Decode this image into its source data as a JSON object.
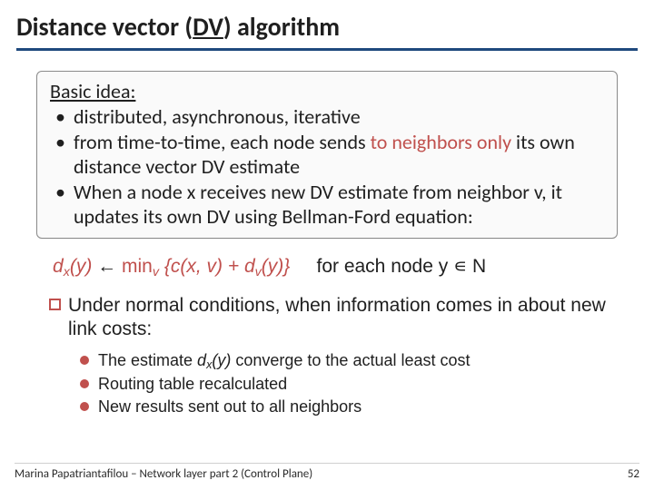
{
  "title": {
    "pre": "Distance vector (",
    "dv": "DV",
    "post": ") algorithm"
  },
  "box": {
    "heading": "Basic idea:",
    "bullets": [
      {
        "pre": "distributed, asynchronous, iterative",
        "accent": "",
        "post": ""
      },
      {
        "pre": "from time-to-time, each node sends ",
        "accent": "to neighbors only ",
        "post": "its own distance vector DV estimate"
      },
      {
        "pre": "When a node x receives new DV estimate from neighbor v, it updates its own DV using Bellman-Ford equation:",
        "accent": "",
        "post": ""
      }
    ]
  },
  "equation": {
    "lhs_var": "d",
    "lhs_sub": "x",
    "lhs_arg": "(y)",
    "arrow": "←",
    "min": "min",
    "min_sub": "v",
    "open": "{",
    "c": "c(x, v) + ",
    "dv_var": "d",
    "dv_sub": "v",
    "dv_arg": "(y)",
    "close": "}",
    "for": "for each node y ",
    "isin": "∊",
    "set": " N"
  },
  "outer": "Under normal conditions, when information comes in about new link costs:",
  "inner": [
    {
      "pre": "The estimate ",
      "var": "d",
      "sub": "x",
      "arg": "(y)",
      "post": " converge to the actual least cost"
    },
    {
      "pre": "Routing table recalculated",
      "var": "",
      "sub": "",
      "arg": "",
      "post": ""
    },
    {
      "pre": "New results sent out to all neighbors",
      "var": "",
      "sub": "",
      "arg": "",
      "post": ""
    }
  ],
  "footer": {
    "left": "Marina Papatriantafilou –  Network layer part 2 (Control Plane)",
    "right": "52"
  }
}
